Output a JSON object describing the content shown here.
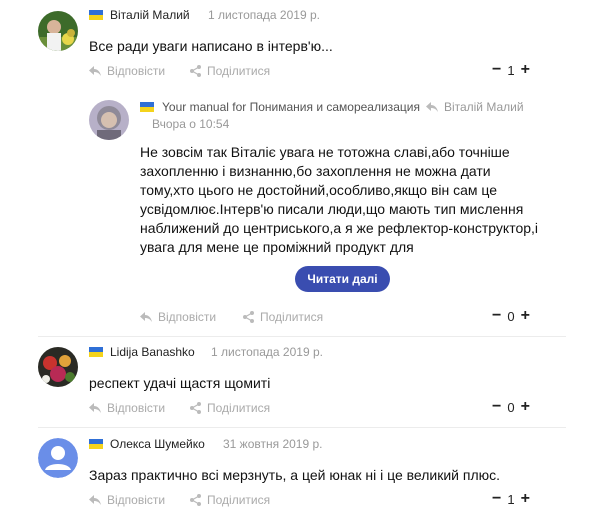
{
  "comments": [
    {
      "author": "Віталій Малий",
      "date": "1 листопада 2019 р.",
      "text": "Все ради уваги написано в інтерв'ю...",
      "reply_label": "Відповісти",
      "share_label": "Поділитися",
      "vote_minus": "−",
      "vote_count": "1",
      "vote_plus": "+"
    },
    {
      "author": "Lidija Banashko",
      "date": "1 листопада 2019 р.",
      "text": "респект удачі щастя щомиті",
      "reply_label": "Відповісти",
      "share_label": "Поділитися",
      "vote_minus": "−",
      "vote_count": "0",
      "vote_plus": "+"
    },
    {
      "author": "Олекса Шумейко",
      "date": "31 жовтня 2019 р.",
      "text": "Зараз практично всі мерзнуть, а цей юнак ні і це великий плюс.",
      "reply_label": "Відповісти",
      "share_label": "Поділитися",
      "vote_minus": "−",
      "vote_count": "1",
      "vote_plus": "+"
    }
  ],
  "reply": {
    "author": "Your manual for Понимания и самореализация",
    "reply_to": "Віталій Малий",
    "date": "Вчора о 10:54",
    "lines": [
      "Не зовсім так Віталіє увага не тотожна славі,або точніше",
      "захопленню і визнанню,бо захоплення не можна дати",
      "тому,хто цього не достойний,особливо,якщо він сам це",
      "усвідомлює.Інтерв'ю писали люди,що мають тип мислення",
      "наближений до центриського,а я же рефлектор-конструктор,і",
      "увага для мене це проміжний продукт для"
    ],
    "read_more": "Читати далі",
    "reply_label": "Відповісти",
    "share_label": "Поділитися",
    "vote_minus": "−",
    "vote_count": "0",
    "vote_plus": "+"
  },
  "colors": {
    "flag_blue": "#2f6fd6",
    "flag_yellow": "#f4d31c",
    "button": "#3a4db0",
    "meta_gray": "#999999"
  }
}
